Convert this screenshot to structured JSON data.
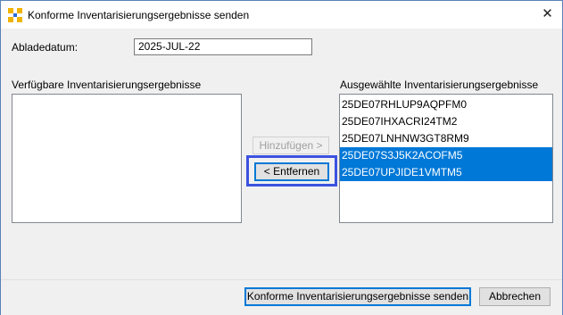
{
  "window": {
    "title": "Konforme Inventarisierungsergebnisse senden",
    "close_glyph": "✕"
  },
  "form": {
    "date_label": "Abladedatum:",
    "date_value": "2025-JUL-22"
  },
  "available": {
    "label": "Verfügbare Inventarisierungsergebnisse",
    "items": []
  },
  "selected": {
    "label": "Ausgewählte Inventarisierungsergebnisse",
    "items": [
      {
        "text": "25DE07RHLUP9AQPFM0",
        "selected": false
      },
      {
        "text": "25DE07IHXACRI24TM2",
        "selected": false
      },
      {
        "text": "25DE07LNHNW3GT8RM9",
        "selected": false
      },
      {
        "text": "25DE07S3J5K2ACOFM5",
        "selected": true
      },
      {
        "text": "25DE07UPJIDE1VMTM5",
        "selected": true
      }
    ]
  },
  "buttons": {
    "add": "Hinzufügen >",
    "remove": "< Entfernen",
    "send": "Konforme Inventarisierungsergebnisse senden",
    "cancel": "Abbrechen"
  },
  "colors": {
    "accent": "#0078d7",
    "highlight": "#3b52e0",
    "app_icon": "#f0b400"
  },
  "icons": {
    "app": "app-icon",
    "close": "close-icon"
  }
}
